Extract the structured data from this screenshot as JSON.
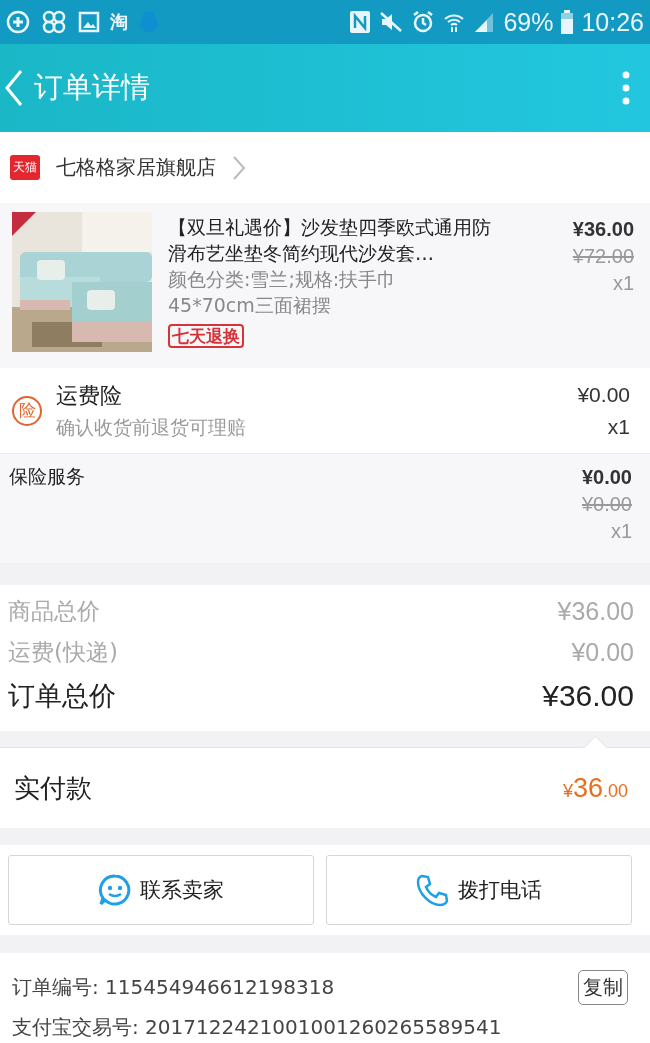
{
  "status_bar": {
    "notification_text": "淘",
    "battery": "69%",
    "time": "10:26"
  },
  "header": {
    "title": "订单详情"
  },
  "shop": {
    "badge": "天猫",
    "name": "七格格家居旗舰店"
  },
  "product": {
    "kind": "picture",
    "title": "【双旦礼遇价】沙发垫四季欧式通用防滑布艺坐垫冬简约现代沙发套…",
    "spec": "颜色分类:雪兰;规格:扶手巾45*70cm三面裙摆",
    "tag": "七天退换",
    "price": "¥36.00",
    "original_price": "¥72.00",
    "quantity": "x1"
  },
  "freight_insurance": {
    "icon_text": "险",
    "name": "运费险",
    "description": "确认收货前退货可理赔",
    "price": "¥0.00",
    "quantity": "x1"
  },
  "insurance_service": {
    "name": "保险服务",
    "price": "¥0.00",
    "original_price": "¥0.00",
    "quantity": "x1"
  },
  "totals": [
    {
      "label": "商品总价",
      "value": "¥36.00",
      "emphasis": false
    },
    {
      "label": "运费(快递)",
      "value": "¥0.00",
      "emphasis": false
    },
    {
      "label": "订单总价",
      "value": "¥36.00",
      "emphasis": true
    }
  ],
  "paid": {
    "label": "实付款",
    "currency": "¥",
    "integer": "36",
    "decimal": ".00"
  },
  "actions": [
    {
      "kind": "chat",
      "label": "联系卖家"
    },
    {
      "kind": "phone",
      "label": "拨打电话"
    }
  ],
  "order_info": [
    {
      "label": "订单编号:",
      "value": "115454946612198318",
      "copy": "复制"
    },
    {
      "label": "支付宝交易号:",
      "value": "2017122421001001260265589541"
    }
  ]
}
